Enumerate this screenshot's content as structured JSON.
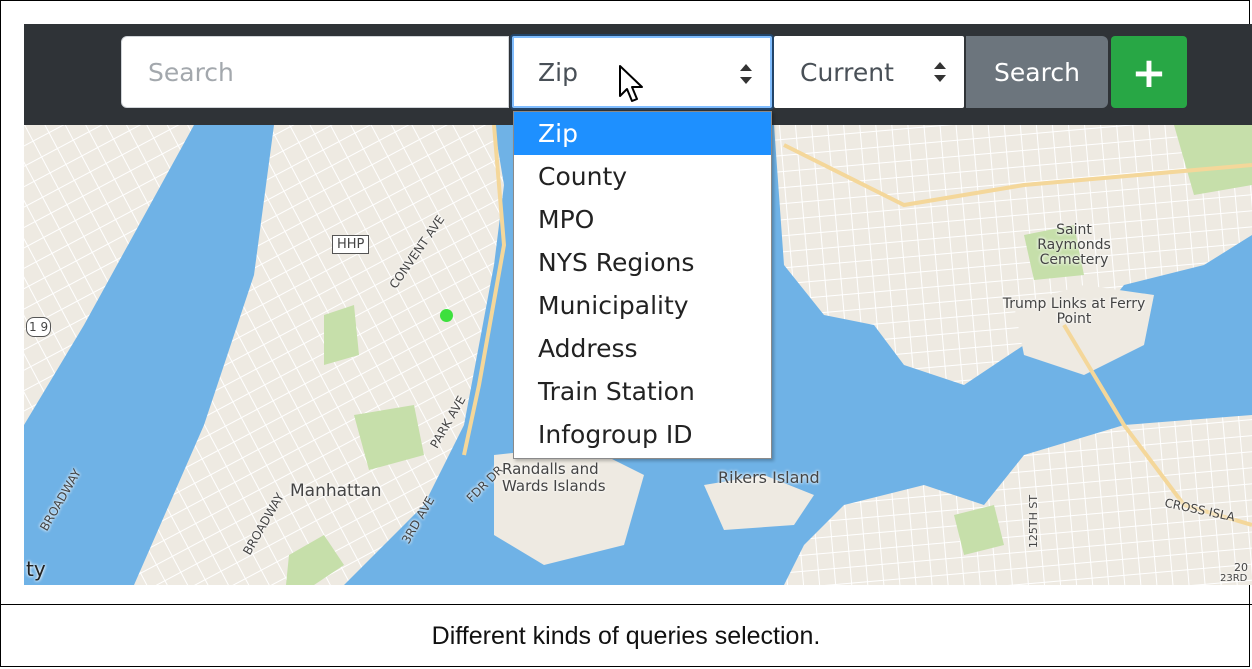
{
  "toolbar": {
    "search_placeholder": "Search",
    "query_type_select": {
      "selected": "Zip"
    },
    "time_select": {
      "selected": "Current"
    },
    "search_button_label": "Search",
    "add_button_label": "+"
  },
  "dropdown": {
    "options": [
      "Zip",
      "County",
      "MPO",
      "NYS Regions",
      "Municipality",
      "Address",
      "Train Station",
      "Infogroup ID"
    ],
    "highlighted": "Zip"
  },
  "map": {
    "labels": {
      "hhp": "HHP",
      "convent_ave": "CONVENT AVE",
      "route_9": "1 9",
      "park_ave": "PARK AVE",
      "broadway_left": "BROADWAY",
      "broadway_mid": "BROADWAY",
      "manhattan": "Manhattan",
      "third_ave": "3RD AVE",
      "fdr_dr": "FDR DR",
      "randalls_wards": "Randalls and Wards Islands",
      "rikers_island": "Rikers Island",
      "saint_raymonds": "Saint Raymonds Cemetery",
      "trump_links": "Trump Links at Ferry Point",
      "street_125th": "125TH ST",
      "cross_island": "CROSS ISLA",
      "edge_ty": "ty",
      "edge_20": "20",
      "edge_23rd": "23RD"
    },
    "colors": {
      "water": "#6fb2e6",
      "land": "#eeeae2",
      "park": "#c6dfaa",
      "marker": "#3de03d"
    }
  },
  "caption": "Different kinds of queries selection."
}
